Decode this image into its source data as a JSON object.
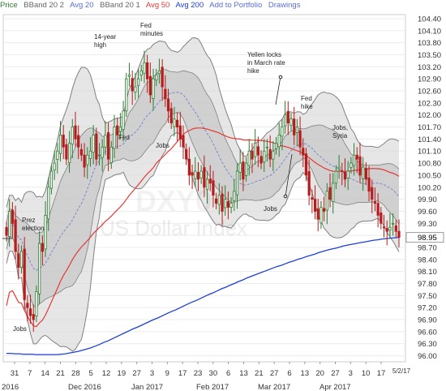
{
  "toolbar": {
    "price_label": "Price",
    "bband20_2_label": "BBand 20 2",
    "avg20_label": "Avg 20",
    "bband20_1_label": "BBand 20 1",
    "avg50_label": "Avg 50",
    "avg200_label": "Avg 200",
    "add_portfolio": "Add to Portfolio",
    "drawings": "Drawings"
  },
  "chart_data": {
    "type": "candlestick",
    "watermark_symbol": "DXY0",
    "watermark_name": "US Dollar Index",
    "y_range": [
      95.85,
      104.5
    ],
    "y_ticks": [
      "104.40",
      "104.10",
      "103.80",
      "103.50",
      "103.20",
      "102.90",
      "102.60",
      "102.30",
      "102.00",
      "101.70",
      "101.40",
      "101.10",
      "100.80",
      "100.50",
      "100.20",
      "99.90",
      "99.60",
      "99.30",
      "99.00",
      "98.70",
      "98.40",
      "98.10",
      "97.80",
      "97.50",
      "97.20",
      "96.90",
      "96.60",
      "96.30",
      "96.00"
    ],
    "last_price": "98.95",
    "x_tick_labels": [
      "31",
      "7",
      "14",
      "21",
      "28",
      "5",
      "12",
      "19",
      "27",
      "3",
      "9",
      "17",
      "23",
      "30",
      "6",
      "13",
      "21",
      "27",
      "6",
      "13",
      "20",
      "27",
      "3",
      "10",
      "17"
    ],
    "month_labels": [
      "2016",
      "Dec 2016",
      "Jan 2017",
      "Feb 2017",
      "Mar 2017",
      "Apr 2017"
    ],
    "x_end_label": "5/2/17",
    "annotations": [
      "Prez election",
      "Jobs",
      "14-year high",
      "Fed minutes",
      "Fed",
      "Jobs",
      "Yellen locks in March rate hike",
      "Fed hike",
      "Jobs",
      "Jobs, Syria"
    ],
    "series": {
      "close": [
        99.0,
        99.6,
        99.3,
        98.6,
        98.2,
        98.6,
        97.4,
        97.2,
        97.0,
        96.9,
        97.6,
        98.8,
        98.6,
        99.5,
        100.2,
        100.6,
        100.8,
        101.1,
        101.5,
        101.2,
        100.9,
        101.3,
        101.7,
        101.4,
        101.2,
        101.0,
        100.7,
        101.0,
        101.1,
        101.5,
        100.9,
        101.0,
        101.2,
        101.5,
        100.9,
        101.2,
        101.7,
        101.5,
        101.7,
        102.1,
        102.9,
        103.0,
        102.6,
        102.7,
        102.9,
        103.1,
        103.3,
        102.9,
        102.5,
        102.9,
        103.0,
        103.1,
        102.7,
        102.4,
        102.1,
        101.8,
        101.9,
        101.7,
        101.4,
        101.2,
        100.9,
        100.5,
        100.5,
        100.6,
        100.4,
        100.6,
        100.2,
        100.4,
        100.3,
        100.0,
        99.8,
        100.0,
        99.6,
        99.9,
        99.7,
        99.8,
        100.1,
        100.6,
        100.8,
        100.4,
        100.8,
        101.1,
        100.9,
        101.3,
        101.0,
        100.8,
        101.1,
        101.2,
        100.9,
        101.1,
        101.3,
        101.5,
        101.7,
        102.0,
        101.8,
        101.9,
        101.5,
        101.7,
        101.2,
        101.0,
        100.5,
        100.0,
        99.9,
        99.6,
        99.4,
        99.7,
        99.6,
        100.1,
        99.9,
        100.3,
        100.6,
        100.7,
        100.6,
        100.4,
        100.6,
        100.8,
        101.0,
        100.9,
        100.5,
        100.7,
        100.4,
        100.1,
        99.9,
        99.8,
        99.5,
        99.3,
        99.2,
        99.1,
        99.2,
        99.3,
        99.1,
        98.95
      ]
    },
    "avg200": [
      96.06,
      96.06,
      96.05,
      96.05,
      96.04,
      96.04,
      96.04,
      96.03,
      96.03,
      96.03,
      96.03,
      96.03,
      96.03,
      96.04,
      96.05,
      96.07,
      96.09,
      96.11,
      96.14,
      96.17,
      96.2,
      96.24,
      96.28,
      96.33,
      96.37,
      96.42,
      96.47,
      96.52,
      96.57,
      96.62,
      96.67,
      96.71,
      96.76,
      96.81,
      96.86,
      96.91,
      96.95,
      97.0,
      97.05,
      97.1,
      97.14,
      97.19,
      97.24,
      97.29,
      97.34,
      97.38,
      97.43,
      97.48,
      97.53,
      97.57,
      97.62,
      97.67,
      97.71,
      97.76,
      97.8,
      97.85,
      97.89,
      97.94,
      97.98,
      98.02,
      98.06,
      98.1,
      98.14,
      98.18,
      98.22,
      98.25,
      98.29,
      98.33,
      98.36,
      98.4,
      98.43,
      98.47,
      98.5,
      98.53,
      98.57,
      98.6,
      98.63,
      98.66,
      98.68,
      98.71,
      98.74,
      98.76,
      98.78,
      98.8,
      98.82,
      98.84,
      98.86,
      98.88,
      98.89,
      98.91,
      98.92,
      98.93,
      98.94,
      98.95
    ]
  },
  "colors": {
    "up": "#2e7d32",
    "down": "#b71c1c",
    "avg20": "#7986cb",
    "avg50": "#e53935",
    "avg200": "#1e3fd6",
    "band_fill": "#d8d8d8",
    "band_inner_fill": "#bdbdbd",
    "band_line": "#808080",
    "grid": "#ececec"
  }
}
